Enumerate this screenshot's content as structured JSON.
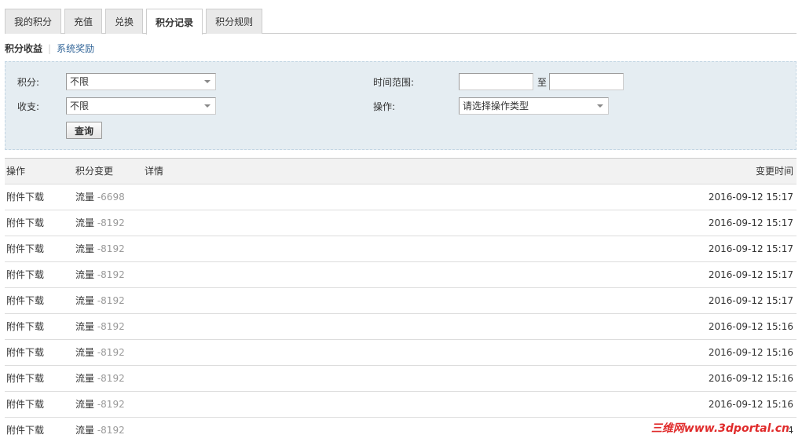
{
  "tabs": [
    {
      "label": "我的积分"
    },
    {
      "label": "充值"
    },
    {
      "label": "兑换"
    },
    {
      "label": "积分记录"
    },
    {
      "label": "积分规则"
    }
  ],
  "subnav": {
    "active": "积分收益",
    "sep": "|",
    "link": "系统奖励"
  },
  "filter": {
    "points_label": "积分:",
    "points_value": "不限",
    "income_label": "收支:",
    "income_value": "不限",
    "time_label": "时间范围:",
    "time_to": "至",
    "action_label": "操作:",
    "action_value": "请选择操作类型",
    "search_button": "查询"
  },
  "table": {
    "headers": {
      "action": "操作",
      "change": "积分变更",
      "detail": "详情",
      "time": "变更时间"
    },
    "rows": [
      {
        "action": "附件下载",
        "type": "流量",
        "amount": "-6698",
        "time": "2016-09-12 15:17"
      },
      {
        "action": "附件下载",
        "type": "流量",
        "amount": "-8192",
        "time": "2016-09-12 15:17"
      },
      {
        "action": "附件下载",
        "type": "流量",
        "amount": "-8192",
        "time": "2016-09-12 15:17"
      },
      {
        "action": "附件下载",
        "type": "流量",
        "amount": "-8192",
        "time": "2016-09-12 15:17"
      },
      {
        "action": "附件下载",
        "type": "流量",
        "amount": "-8192",
        "time": "2016-09-12 15:17"
      },
      {
        "action": "附件下载",
        "type": "流量",
        "amount": "-8192",
        "time": "2016-09-12 15:16"
      },
      {
        "action": "附件下载",
        "type": "流量",
        "amount": "-8192",
        "time": "2016-09-12 15:16"
      },
      {
        "action": "附件下载",
        "type": "流量",
        "amount": "-8192",
        "time": "2016-09-12 15:16"
      },
      {
        "action": "附件下载",
        "type": "流量",
        "amount": "-8192",
        "time": "2016-09-12 15:16"
      },
      {
        "action": "附件下载",
        "type": "流量",
        "amount": "-8192",
        "time": "4"
      }
    ]
  },
  "watermark": "三维网www.3dportal.cn"
}
